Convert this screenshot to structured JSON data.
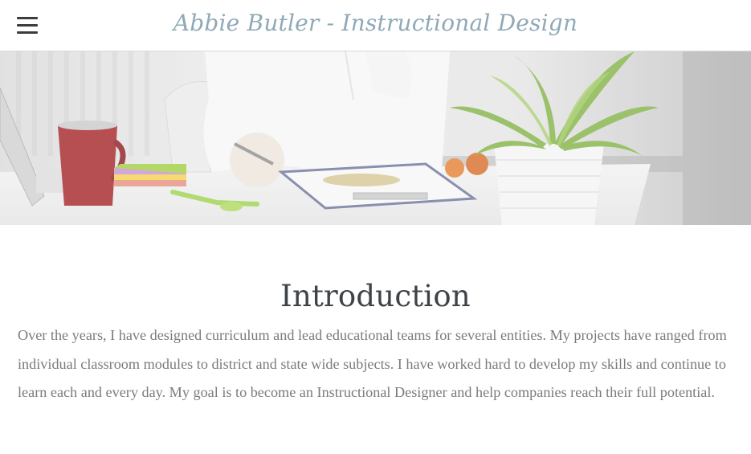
{
  "header": {
    "menu_icon": "hamburger-menu-icon",
    "title": "Abbie Butler - Instructional Design"
  },
  "banner": {
    "image": "desk-workspace-photo",
    "description_icon": "banner-image"
  },
  "main": {
    "heading": "Introduction",
    "paragraph": "Over the years, I have designed curriculum and lead educational teams for several entities.  My projects have ranged from individual classroom modules to district and state wide subjects.  I have worked hard to develop my skills and continue to learn each and every day.  My goal is to become an Instructional Designer and help companies reach their full potential."
  },
  "colors": {
    "title": "#8fa9b6",
    "heading": "#3f4347",
    "body_text": "#7b7b7b",
    "menu_icon": "#3c3c3c"
  }
}
